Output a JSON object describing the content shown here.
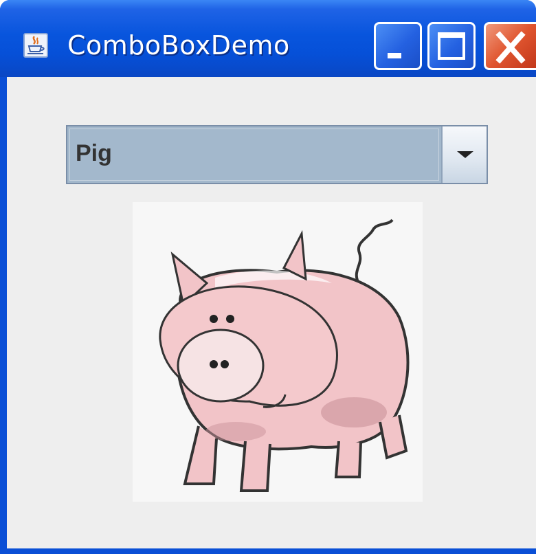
{
  "window": {
    "title": "ComboBoxDemo",
    "buttons": [
      "minimize",
      "maximize",
      "close"
    ]
  },
  "combo": {
    "selected": "Pig"
  },
  "image": {
    "subject": "pig",
    "icon": "pig-illustration"
  },
  "colors": {
    "titlebar": "#0855dd",
    "close_button": "#e0552f",
    "combo_bg": "#a3b8cc",
    "content_bg": "#eeeeee",
    "pig_pink": "#f2c4c8"
  }
}
